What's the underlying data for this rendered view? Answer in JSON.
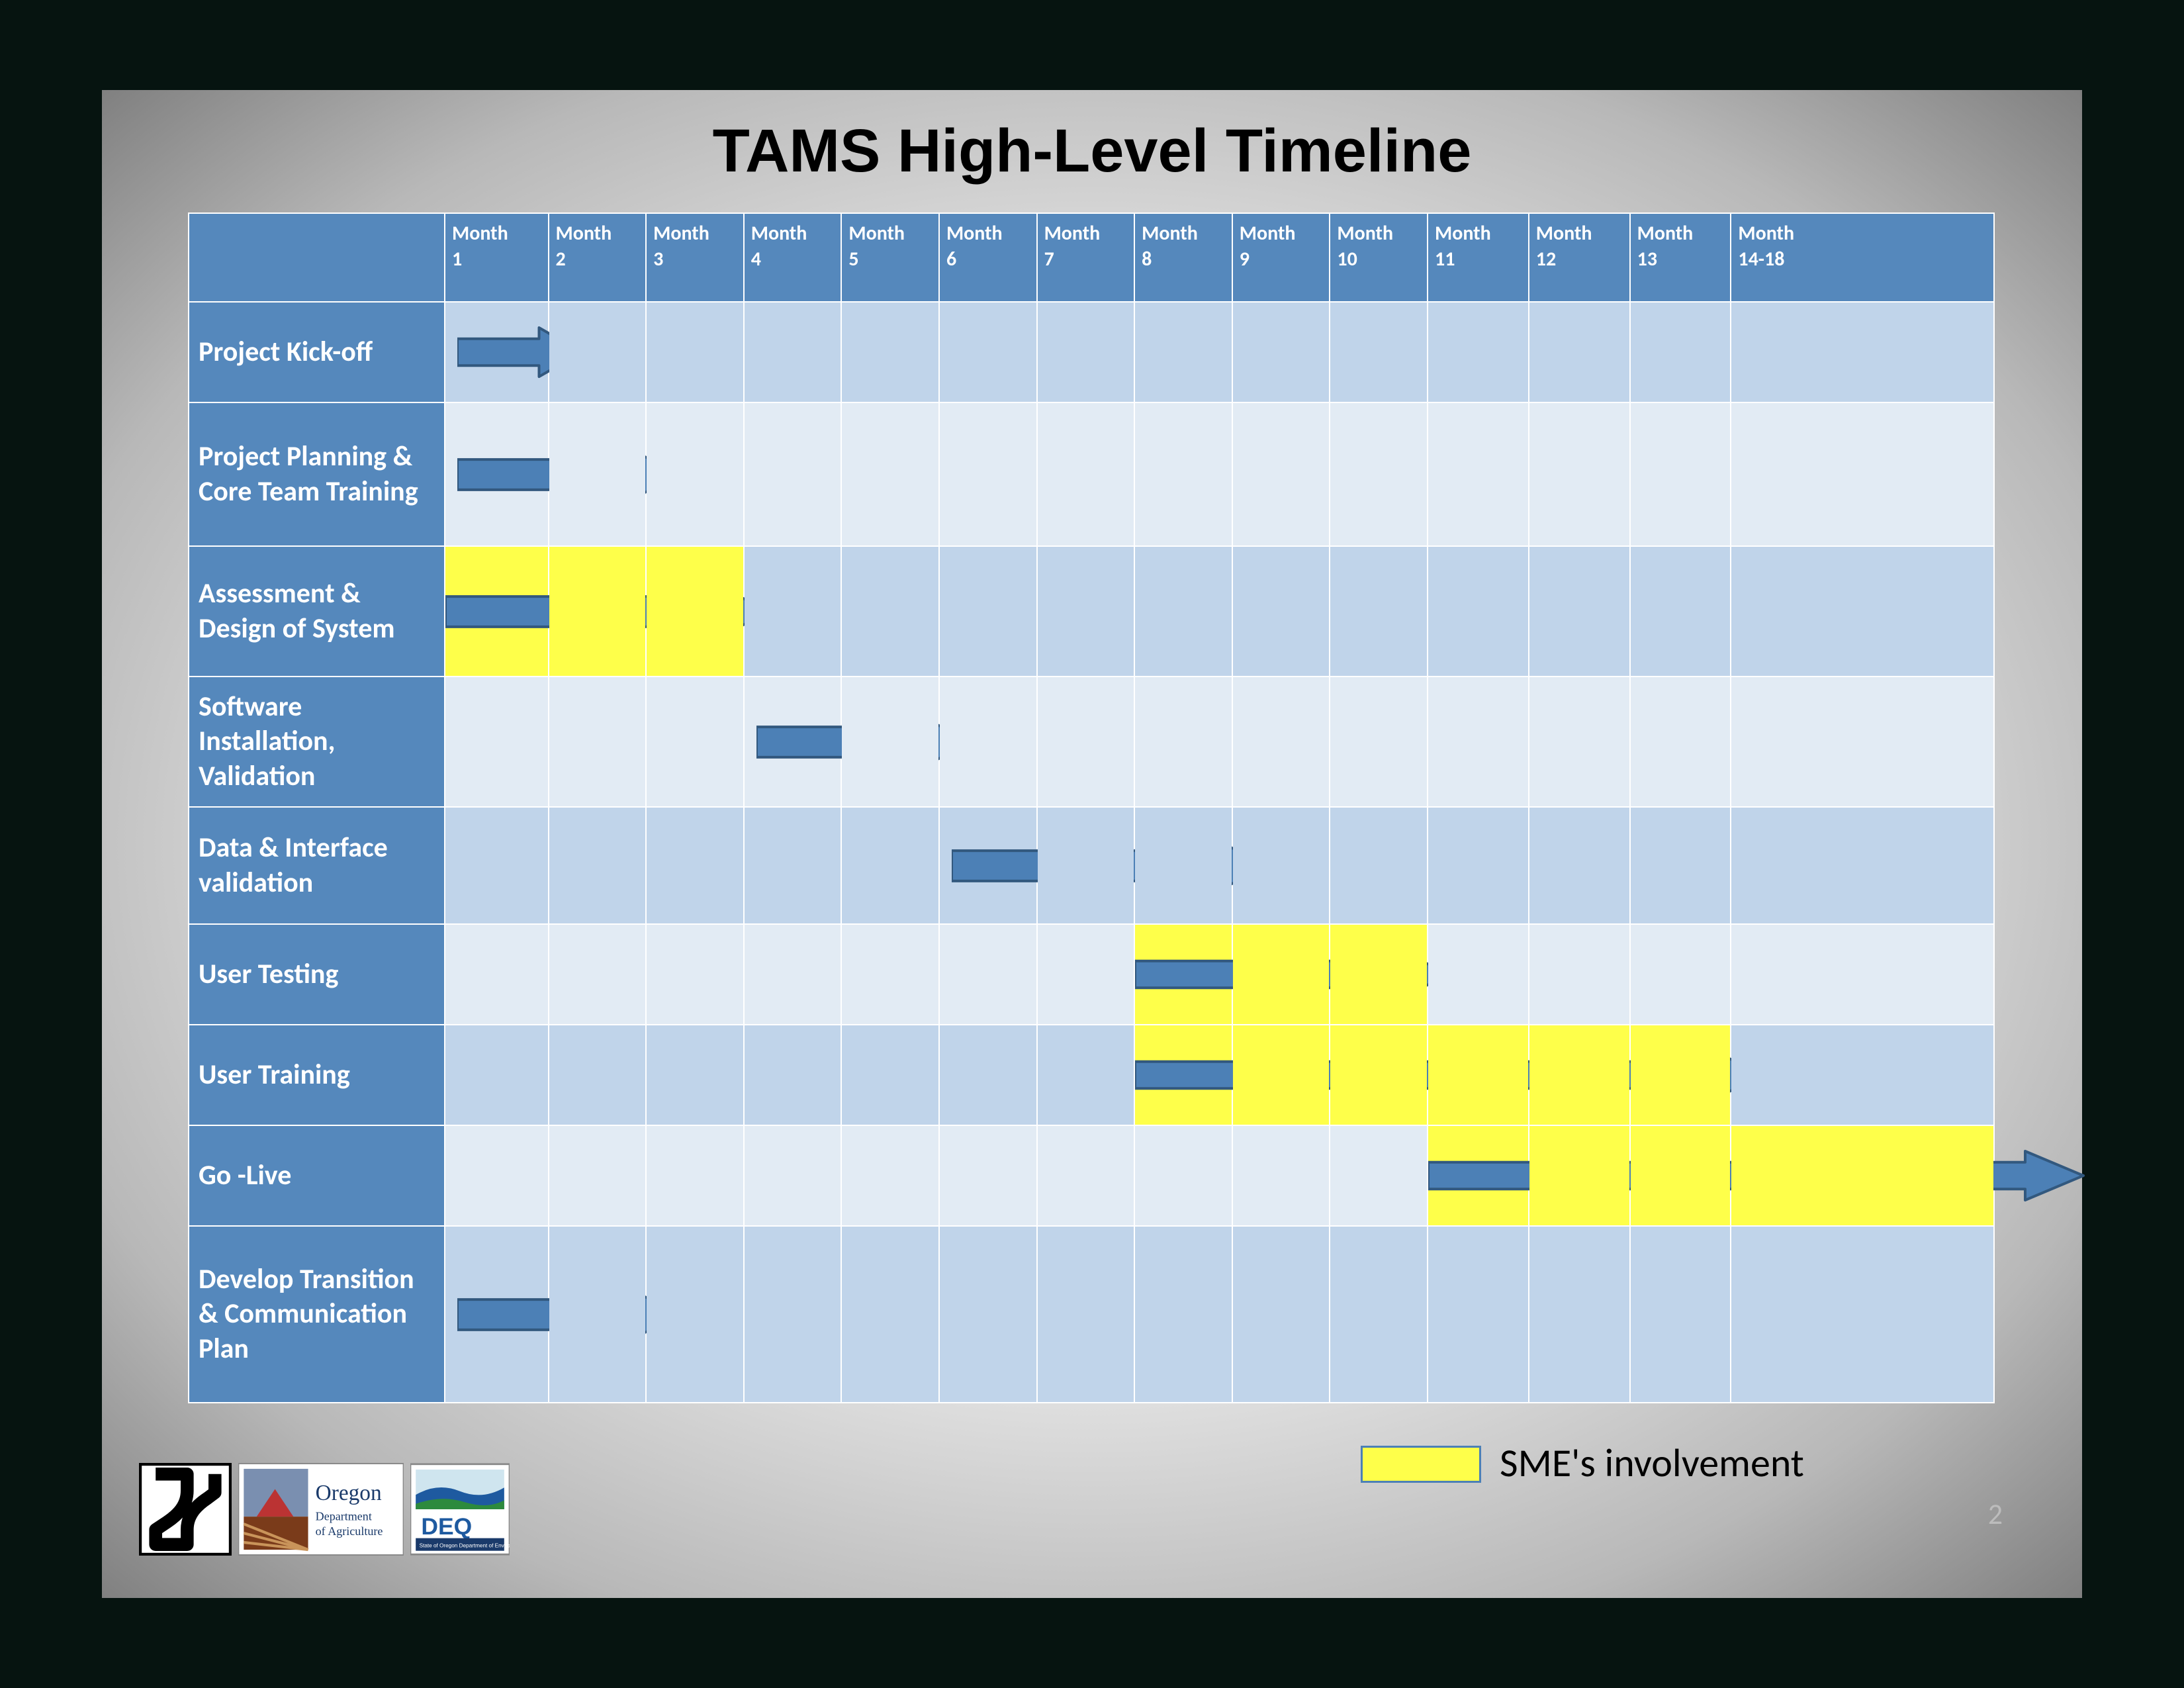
{
  "title": "TAMS High-Level Timeline",
  "slide_number": "2",
  "legend": {
    "label": "SME's involvement"
  },
  "months": [
    {
      "top": "Month",
      "bot": "1"
    },
    {
      "top": "Month",
      "bot": "2"
    },
    {
      "top": "Month",
      "bot": "3"
    },
    {
      "top": "Month",
      "bot": "4"
    },
    {
      "top": "Month",
      "bot": "5"
    },
    {
      "top": "Month",
      "bot": "6"
    },
    {
      "top": "Month",
      "bot": "7"
    },
    {
      "top": "Month",
      "bot": "8"
    },
    {
      "top": "Month",
      "bot": "9"
    },
    {
      "top": "Month",
      "bot": "10"
    },
    {
      "top": "Month",
      "bot": "11"
    },
    {
      "top": "Month",
      "bot": "12"
    },
    {
      "top": "Month",
      "bot": "13"
    },
    {
      "top": "Month",
      "bot": "14-18"
    }
  ],
  "chart_data": {
    "type": "gantt",
    "title": "TAMS High-Level Timeline",
    "x_categories": [
      "Month 1",
      "Month 2",
      "Month 3",
      "Month 4",
      "Month 5",
      "Month 6",
      "Month 7",
      "Month 8",
      "Month 9",
      "Month 10",
      "Month 11",
      "Month 12",
      "Month 13",
      "Month 14-18"
    ],
    "legend": [
      {
        "label": "SME's involvement",
        "style": "yellow-highlight"
      }
    ],
    "tasks": [
      {
        "name": "Project Kick-off",
        "start": 1,
        "end": 1,
        "sme": false
      },
      {
        "name": "Project Planning & Core Team Training",
        "start": 1,
        "end": 2,
        "sme": false
      },
      {
        "name": "Assessment & Design of System",
        "start": 1,
        "end": 3,
        "sme": true
      },
      {
        "name": "Software Installation, Validation",
        "start": 4,
        "end": 5,
        "sme": false
      },
      {
        "name": "Data & Interface validation",
        "start": 6,
        "end": 8,
        "sme": false
      },
      {
        "name": "User Testing",
        "start": 8,
        "end": 10,
        "sme": true
      },
      {
        "name": "User Training",
        "start": 8,
        "end": 13,
        "sme": true
      },
      {
        "name": "Go -Live",
        "start": 11,
        "end": 14,
        "sme": true
      },
      {
        "name": "Develop Transition & Communication Plan",
        "start": 1,
        "end": 2,
        "sme": false
      }
    ]
  }
}
